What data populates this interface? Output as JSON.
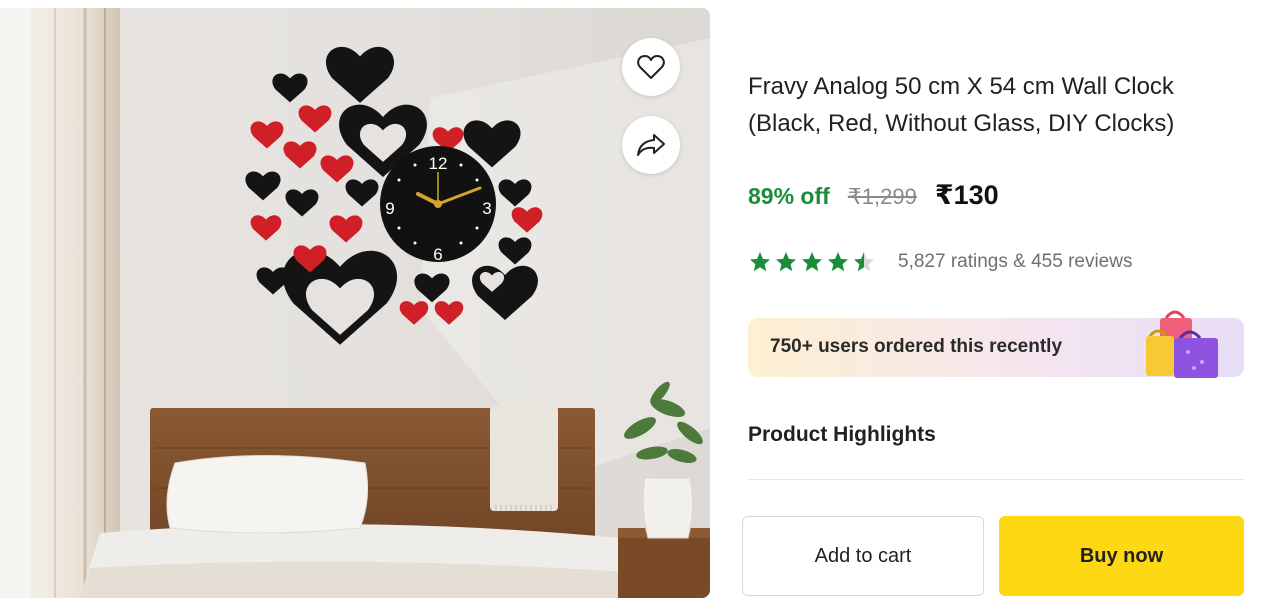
{
  "product": {
    "title": "Fravy Analog 50 cm X 54 cm Wall Clock (Black, Red, Without Glass, DIY Clocks)",
    "image_alt_icon": "wall-clock-product-image",
    "clock_numbers": [
      "12",
      "3",
      "6",
      "9"
    ]
  },
  "actions": {
    "wishlist_icon": "heart-outline-icon",
    "share_icon": "share-arrow-icon",
    "add_to_cart_label": "Add to cart",
    "buy_now_label": "Buy now"
  },
  "pricing": {
    "discount": "89% off",
    "mrp": "₹1,299",
    "price": "₹130"
  },
  "rating": {
    "stars": 4.5,
    "ratings_text": "5,827 ratings",
    "reviews_text": "& 455 reviews",
    "star_color": "#1a8d3a"
  },
  "promo": {
    "text": "750+ users ordered this recently",
    "icon": "shopping-bags-icon"
  },
  "sections": {
    "highlights_title": "Product Highlights"
  },
  "colors": {
    "buy_now": "#ffd814",
    "discount_green": "#1a8d3a"
  }
}
